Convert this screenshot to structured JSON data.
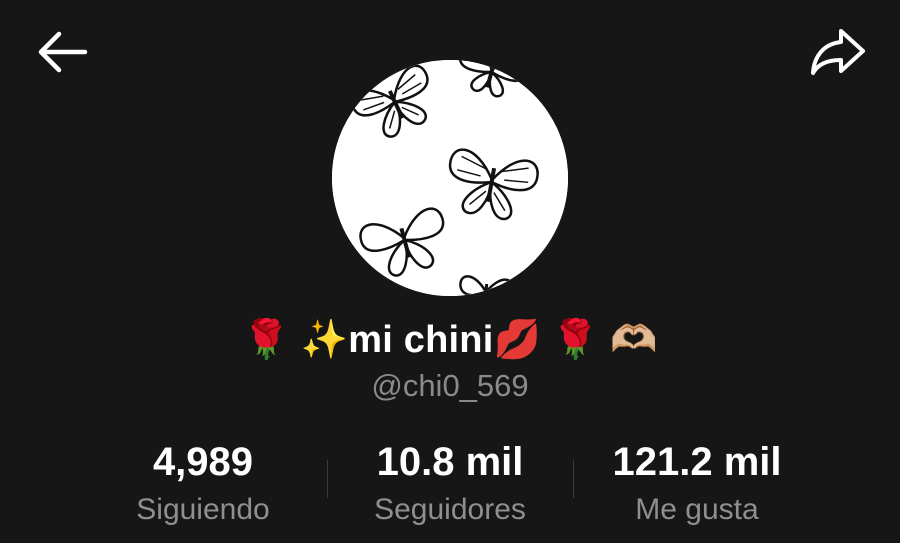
{
  "header": {
    "back_icon": "arrow-left-icon",
    "share_icon": "share-arrow-icon"
  },
  "profile": {
    "avatar_description_icon": "butterfly-avatar",
    "display_name": "🌹 ✨mi chini💋 🌹 🫶🏼",
    "username": "@chi0_569"
  },
  "stats": {
    "following": {
      "value": "4,989",
      "label": "Siguiendo"
    },
    "followers": {
      "value": "10.8 mil",
      "label": "Seguidores"
    },
    "likes": {
      "value": "121.2 mil",
      "label": "Me gusta"
    }
  },
  "colors": {
    "background": "#161616",
    "primary_text": "#ffffff",
    "secondary_text": "#8a8a8a"
  }
}
